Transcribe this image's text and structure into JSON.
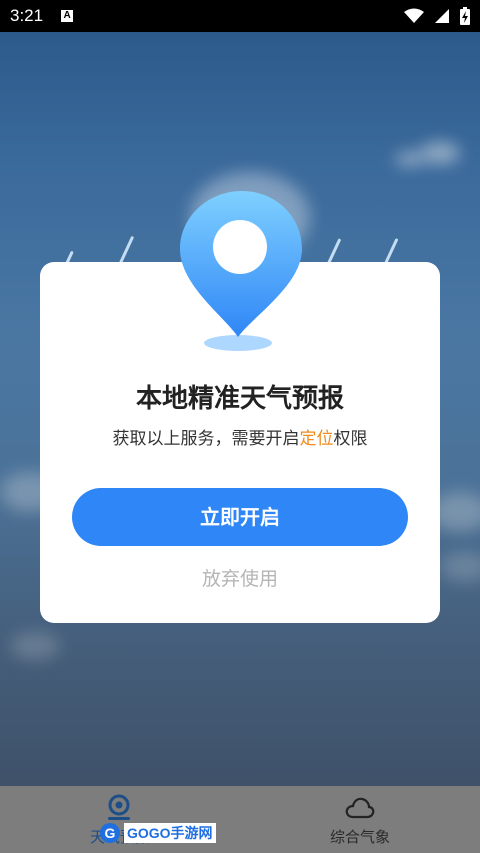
{
  "status_bar": {
    "time": "3:21",
    "notif_letter": "A",
    "icons": [
      "wifi-icon",
      "signal-icon",
      "battery-icon"
    ]
  },
  "dialog": {
    "title": "本地精准天气预报",
    "subtitle_prefix": "获取以上服务，需要开启",
    "subtitle_highlight": "定位",
    "subtitle_suffix": "权限",
    "primary_button": "立即开启",
    "secondary_button": "放弃使用",
    "colors": {
      "primary": "#2f86f6",
      "highlight": "#f08a1c"
    }
  },
  "bottom_nav": {
    "items": [
      {
        "label": "天气预报",
        "icon": "location-icon"
      },
      {
        "label": "综合气象",
        "icon": "cloud-icon"
      }
    ]
  },
  "watermark": {
    "logo": "G",
    "text": "GOGO手游网"
  }
}
